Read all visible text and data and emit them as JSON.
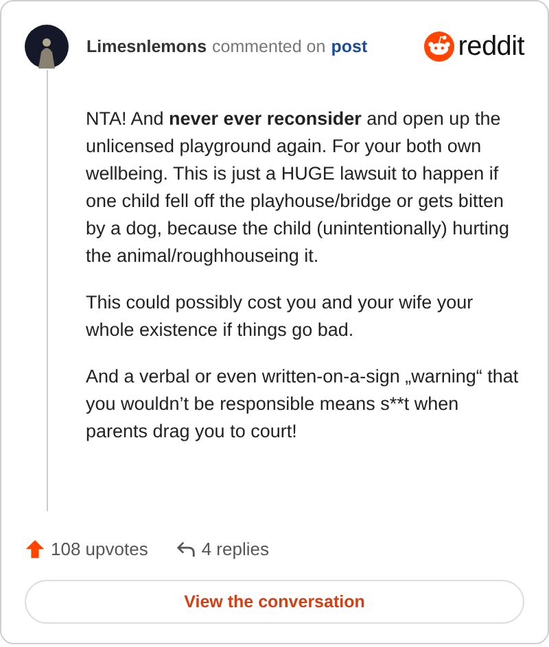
{
  "header": {
    "author": "Limesnlemons",
    "action": "commented on",
    "link": "post",
    "brand": "reddit"
  },
  "paragraphs": [
    "NTA! And **never ever reconsider** and open up the unlicensed playground again. For your both own wellbeing. This is just a HUGE lawsuit to happen if one child fell off the playhouse/bridge or gets bitten by a dog, because the child (unintentionally) hurting the animal/roughhouseing it.",
    "This could possibly cost you and your wife your whole existence if things go bad.",
    "And a verbal or even written-on-a-sign „warning“ that you wouldn’t be responsible means s**t when parents drag you to court!"
  ],
  "footer": {
    "upvotes": "108 upvotes",
    "replies": "4 replies",
    "button": "View the conversation"
  }
}
